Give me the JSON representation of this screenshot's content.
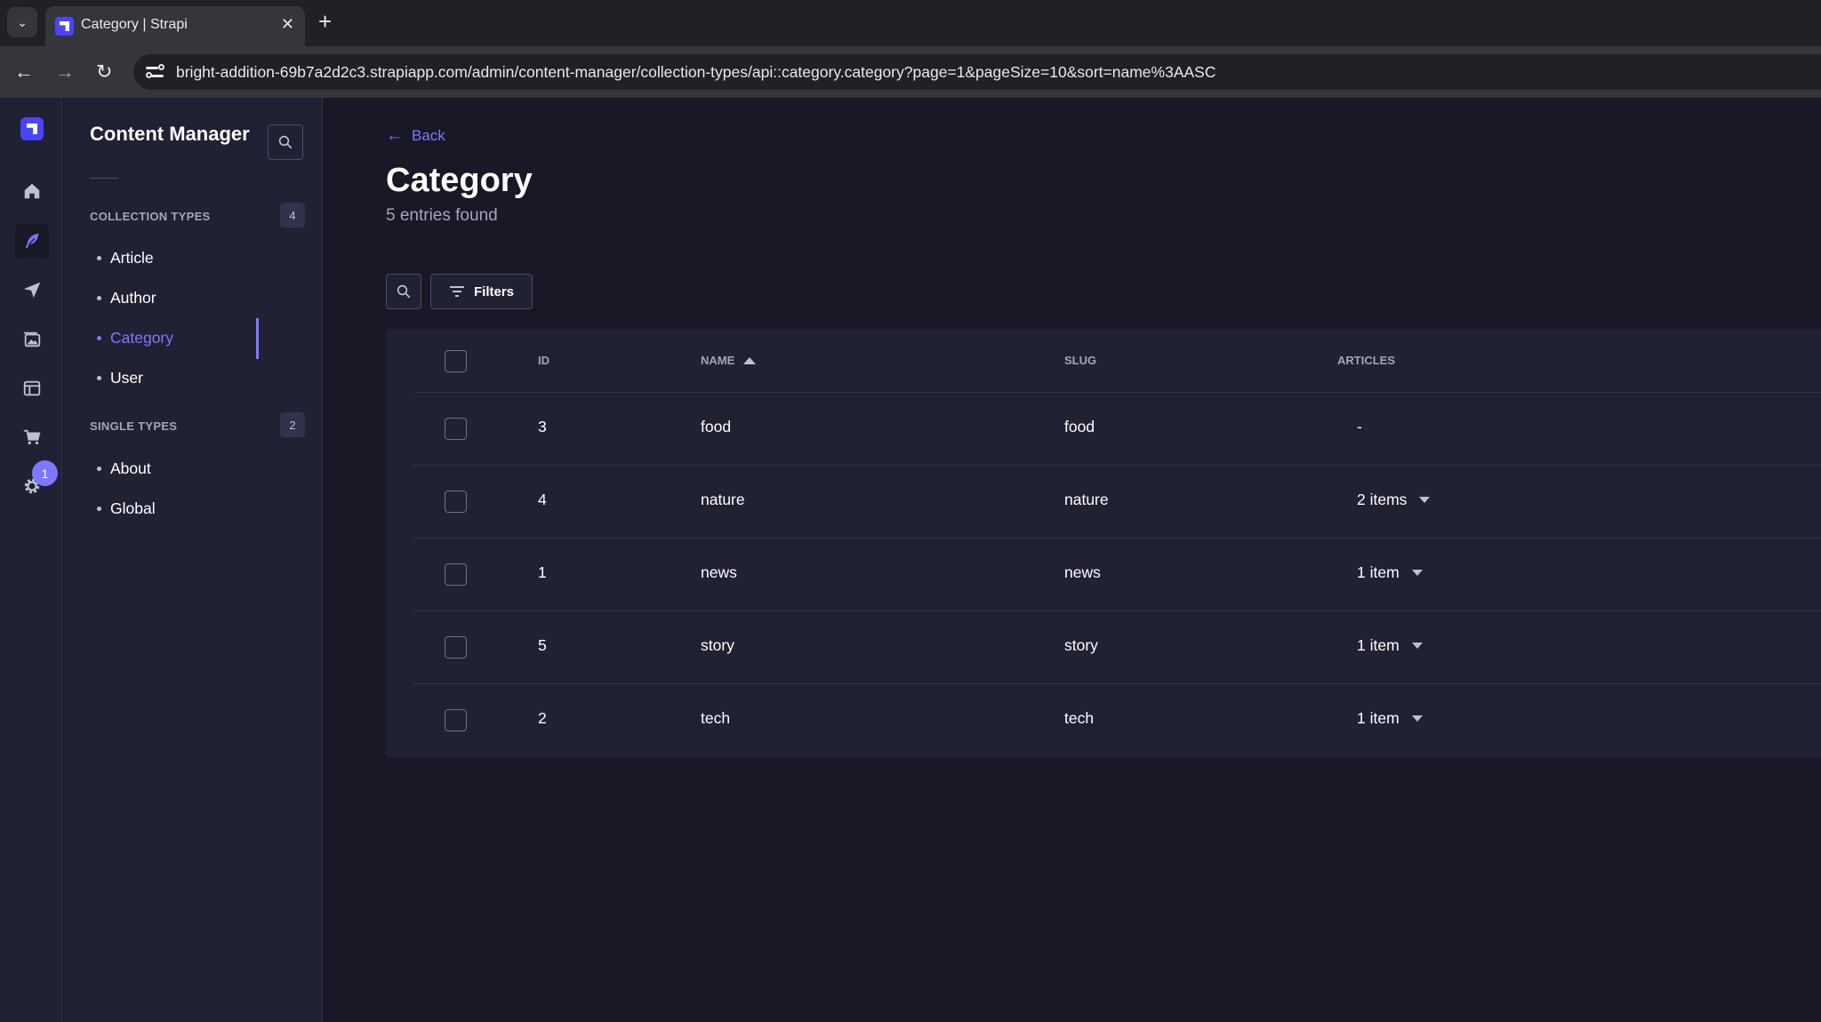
{
  "browser": {
    "tab_title": "Category | Strapi",
    "url": "bright-addition-69b7a2d2c3.strapiapp.com/admin/content-manager/collection-types/api::category.category?page=1&pageSize=10&sort=name%3AASC"
  },
  "rail": {
    "settings_badge": "1"
  },
  "subnav": {
    "title": "Content Manager",
    "collection_types_label": "COLLECTION TYPES",
    "collection_types_count": "4",
    "collection_types": [
      "Article",
      "Author",
      "Category",
      "User"
    ],
    "single_types_label": "SINGLE TYPES",
    "single_types_count": "2",
    "single_types": [
      "About",
      "Global"
    ]
  },
  "header": {
    "back_label": "Back",
    "title": "Category",
    "subtitle": "5 entries found"
  },
  "actions": {
    "filters_label": "Filters"
  },
  "table": {
    "columns": {
      "id": "ID",
      "name": "NAME",
      "slug": "SLUG",
      "articles": "ARTICLES"
    },
    "rows": [
      {
        "id": "3",
        "name": "food",
        "slug": "food",
        "articles": "-"
      },
      {
        "id": "4",
        "name": "nature",
        "slug": "nature",
        "articles": "2 items"
      },
      {
        "id": "1",
        "name": "news",
        "slug": "news",
        "articles": "1 item"
      },
      {
        "id": "5",
        "name": "story",
        "slug": "story",
        "articles": "1 item"
      },
      {
        "id": "2",
        "name": "tech",
        "slug": "tech",
        "articles": "1 item"
      }
    ]
  },
  "colors": {
    "accent": "#7b79ff",
    "brand": "#4945ff",
    "background": "#181826",
    "surface": "#212134"
  }
}
